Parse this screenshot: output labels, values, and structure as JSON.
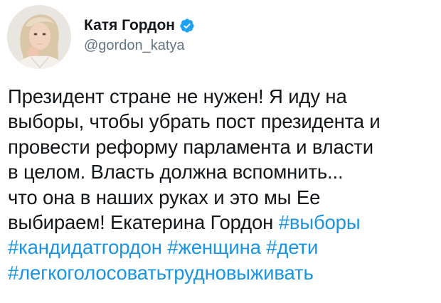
{
  "tweet": {
    "author": {
      "display_name": "Катя Гордон",
      "handle": "@gordon_katya",
      "verified": true,
      "avatar_icon": "profile-photo"
    },
    "lines": [
      [
        {
          "text": "Президент стране не нужен! Я иду на",
          "hashtag": false
        }
      ],
      [
        {
          "text": "выборы, чтобы убрать пост президента и",
          "hashtag": false
        }
      ],
      [
        {
          "text": "провести реформу парламента и власти",
          "hashtag": false
        }
      ],
      [
        {
          "text": "в целом. Власть должна вспомнить...",
          "hashtag": false
        }
      ],
      [
        {
          "text": "что она в наших руках и это мы Ее",
          "hashtag": false
        }
      ],
      [
        {
          "text": "выбираем! Екатерина Гордон ",
          "hashtag": false
        },
        {
          "text": "#выборы",
          "hashtag": true
        }
      ],
      [
        {
          "text": "#кандидатгордон",
          "hashtag": true
        },
        {
          "text": " ",
          "hashtag": false
        },
        {
          "text": "#женщина",
          "hashtag": true
        },
        {
          "text": " ",
          "hashtag": false
        },
        {
          "text": "#дети",
          "hashtag": true
        }
      ],
      [
        {
          "text": "#легкоголосоватьтрудновыживать",
          "hashtag": true
        }
      ]
    ]
  },
  "colors": {
    "text": "#14171a",
    "secondary_text": "#657786",
    "hashtag": "#1b95e0",
    "verified_badge": "#1da1f2"
  }
}
